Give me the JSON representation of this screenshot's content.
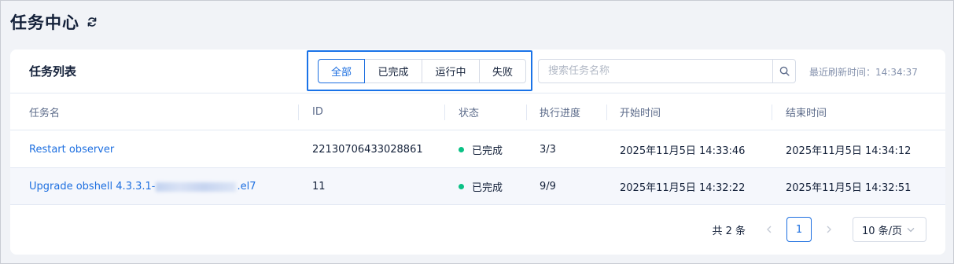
{
  "page": {
    "title": "任务中心",
    "refresh_icon": "refresh-icon"
  },
  "card": {
    "title": "任务列表",
    "filters": [
      {
        "label": "全部",
        "active": true
      },
      {
        "label": "已完成",
        "active": false
      },
      {
        "label": "运行中",
        "active": false
      },
      {
        "label": "失败",
        "active": false
      }
    ],
    "search": {
      "placeholder": "搜索任务名称",
      "value": "",
      "icon": "search-icon"
    },
    "refresh_label": "最近刷新时间：",
    "refresh_time": "14:34:37"
  },
  "table": {
    "columns": [
      "任务名",
      "ID",
      "状态",
      "执行进度",
      "开始时间",
      "结束时间"
    ],
    "rows": [
      {
        "name": "Restart observer",
        "id": "22130706433028861",
        "status": "已完成",
        "progress": "3/3",
        "start": "2025年11月5日 14:33:46",
        "end": "2025年11月5日 14:34:12"
      },
      {
        "name_prefix": "Upgrade obshell 4.3.3.1-",
        "name_suffix": ".el7",
        "id": "11",
        "status": "已完成",
        "progress": "9/9",
        "start": "2025年11月5日 14:32:22",
        "end": "2025年11月5日 14:32:51"
      }
    ]
  },
  "pagination": {
    "total": "共 2 条",
    "current_page": "1",
    "page_size": "10 条/页"
  },
  "colors": {
    "accent": "#1d6fe0",
    "success": "#0ac185",
    "highlight_box": "#1a73e8"
  }
}
